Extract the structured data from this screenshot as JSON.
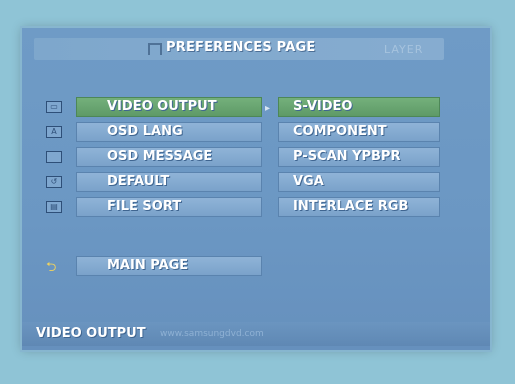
{
  "title": {
    "text": "PREFERENCES PAGE",
    "ghost": "LAYER"
  },
  "menu": [
    {
      "label": "VIDEO OUTPUT",
      "icon": "monitor-icon",
      "selected": true
    },
    {
      "label": "OSD LANG",
      "icon": "language-icon",
      "selected": false
    },
    {
      "label": "OSD MESSAGE",
      "icon": "message-icon",
      "selected": false
    },
    {
      "label": "DEFAULT",
      "icon": "reset-icon",
      "selected": false
    },
    {
      "label": "FILE SORT",
      "icon": "folder-icon",
      "selected": false
    }
  ],
  "main_page": {
    "label": "MAIN PAGE",
    "icon": "back-arrow-icon"
  },
  "options": [
    {
      "label": "S-VIDEO",
      "selected": true
    },
    {
      "label": "COMPONENT",
      "selected": false
    },
    {
      "label": "P-SCAN YPBPR",
      "selected": false
    },
    {
      "label": "VGA",
      "selected": false
    },
    {
      "label": "INTERLACE RGB",
      "selected": false
    }
  ],
  "status": {
    "label": "VIDEO OUTPUT",
    "watermark": "www.samsungdvd.com"
  },
  "colors": {
    "selected": "#5e9a67",
    "item": "#7aa2ca",
    "screen": "#6b97c3",
    "outer": "#8fc4d6"
  }
}
